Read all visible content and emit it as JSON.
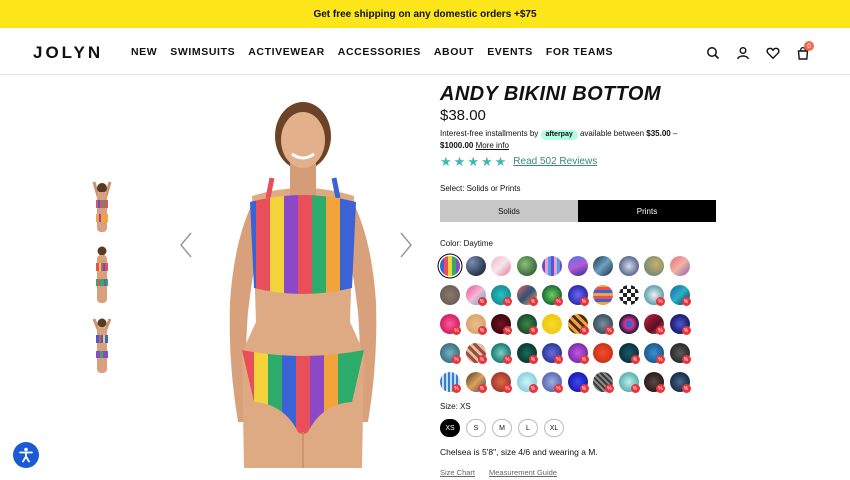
{
  "banner": {
    "text": "Get free shipping on any domestic orders +$75"
  },
  "header": {
    "logo": "JOLYN",
    "nav": [
      "NEW",
      "SWIMSUITS",
      "ACTIVEWEAR",
      "ACCESSORIES",
      "ABOUT",
      "EVENTS",
      "FOR TEAMS"
    ],
    "icons": [
      "search-icon",
      "account-icon",
      "heart-icon",
      "cart-icon"
    ],
    "cart_count": "0"
  },
  "product": {
    "title": "ANDY BIKINI BOTTOM",
    "price": "$38.00",
    "afterpay": {
      "prefix": "Interest-free installments by",
      "logo": "afterpay",
      "middle": "available between",
      "min": "$35.00",
      "dash": "–",
      "max": "$1000.00",
      "link": "More info"
    },
    "rating_stars": 5,
    "reviews_link": "Read 502 Reviews",
    "select_label": "Select: Solids or Prints",
    "toggle": {
      "solids": "Solids",
      "prints": "Prints",
      "selected": "Prints"
    },
    "color_label": "Color: Daytime",
    "size_label": "Size: XS",
    "sizes": [
      "XS",
      "S",
      "M",
      "L",
      "XL"
    ],
    "selected_size": "XS",
    "model_note": "Chelsea is 5'8\", size 4/6 and wearing a M.",
    "size_chart": "Size Chart",
    "measurement_guide": "Measurement Guide",
    "sale_badge": "%"
  },
  "colors": {
    "accent_yellow": "#fce619",
    "star": "#3cb9b3",
    "afterpay_mint": "#b2fce4",
    "sale_red": "#e8333a",
    "a11y_blue": "#1a5ad3"
  }
}
